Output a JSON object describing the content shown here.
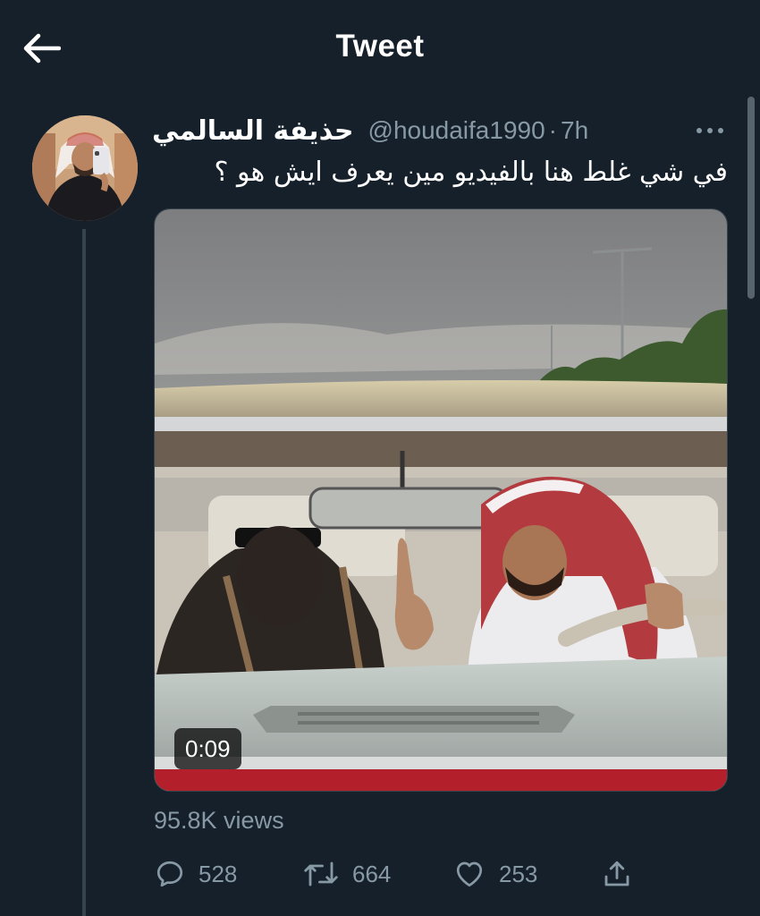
{
  "header": {
    "title": "Tweet",
    "back_icon": "arrow-left-icon"
  },
  "tweet": {
    "display_name": "حذيفة السالمي",
    "handle": "@houdaifa1990",
    "separator": "·",
    "time": "7h",
    "more_icon": "more-horizontal-icon",
    "text": "في شي غلط هنا بالفيديو مين يعرف ايش هو ؟",
    "media": {
      "type": "video",
      "duration": "0:09"
    },
    "views": "95.8K views",
    "actions": {
      "reply": {
        "icon": "reply-icon",
        "count": "528"
      },
      "retweet": {
        "icon": "retweet-icon",
        "count": "664"
      },
      "like": {
        "icon": "heart-icon",
        "count": "253"
      },
      "share": {
        "icon": "share-icon"
      }
    }
  },
  "colors": {
    "background": "#15202b",
    "text_primary": "#ffffff",
    "text_secondary": "#8899a6",
    "border": "#38444d"
  }
}
